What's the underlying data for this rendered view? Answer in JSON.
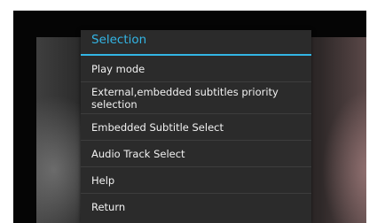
{
  "dialog": {
    "title": "Selection",
    "accent_color": "#33b5e5"
  },
  "menu": {
    "items": [
      {
        "label": "Play mode"
      },
      {
        "label": "External,embedded subtitles priority selection"
      },
      {
        "label": "Embedded Subtitle Select"
      },
      {
        "label": "Audio Track Select"
      },
      {
        "label": "Help"
      },
      {
        "label": "Return"
      }
    ]
  }
}
